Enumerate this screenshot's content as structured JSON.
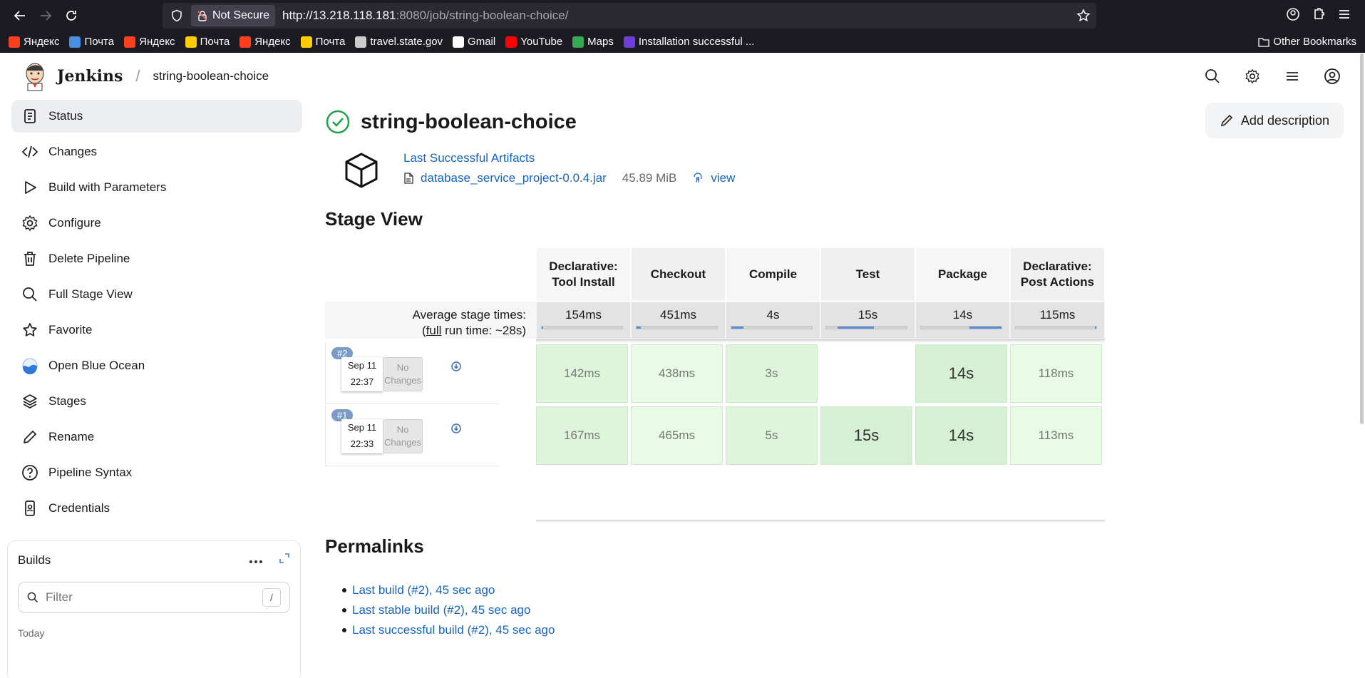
{
  "browser": {
    "not_secure_label": "Not Secure",
    "url_host": "http://13.218.118.181",
    "url_rest": ":8080/job/string-boolean-choice/",
    "bookmarks": [
      {
        "label": "Яндекс",
        "icon": "yandex-icon",
        "color": "#fc3f1d"
      },
      {
        "label": "Почта",
        "icon": "mail-icon",
        "color": "#4a90e2"
      },
      {
        "label": "Яндекс",
        "icon": "yandex-icon",
        "color": "#fc3f1d"
      },
      {
        "label": "Почта",
        "icon": "yandex-mail-icon",
        "color": "#ffcc00"
      },
      {
        "label": "Яндекс",
        "icon": "yandex-icon",
        "color": "#fc3f1d"
      },
      {
        "label": "Почта",
        "icon": "yandex-mail-icon",
        "color": "#ffcc00"
      },
      {
        "label": "travel.state.gov",
        "icon": "site-icon",
        "color": "#cccccc"
      },
      {
        "label": "Gmail",
        "icon": "google-icon",
        "color": "#ffffff"
      },
      {
        "label": "YouTube",
        "icon": "youtube-icon",
        "color": "#ff0000"
      },
      {
        "label": "Maps",
        "icon": "maps-icon",
        "color": "#34a853"
      },
      {
        "label": "Installation successful ...",
        "icon": "install-icon",
        "color": "#6c3fd6"
      }
    ],
    "other_bookmarks": "Other Bookmarks"
  },
  "header": {
    "brand": "Jenkins",
    "breadcrumb": "string-boolean-choice"
  },
  "sidebar": {
    "items": [
      {
        "label": "Status",
        "icon": "status-icon"
      },
      {
        "label": "Changes",
        "icon": "code-icon"
      },
      {
        "label": "Build with Parameters",
        "icon": "play-icon"
      },
      {
        "label": "Configure",
        "icon": "gear-icon"
      },
      {
        "label": "Delete Pipeline",
        "icon": "trash-icon"
      },
      {
        "label": "Full Stage View",
        "icon": "search-icon"
      },
      {
        "label": "Favorite",
        "icon": "star-icon"
      },
      {
        "label": "Open Blue Ocean",
        "icon": "blue-ocean-icon"
      },
      {
        "label": "Stages",
        "icon": "layers-icon"
      },
      {
        "label": "Rename",
        "icon": "pencil-icon"
      },
      {
        "label": "Pipeline Syntax",
        "icon": "help-icon"
      },
      {
        "label": "Credentials",
        "icon": "credentials-icon"
      }
    ],
    "builds": {
      "title": "Builds",
      "filter_placeholder": "Filter",
      "shortcut": "/",
      "group_label": "Today"
    }
  },
  "main": {
    "title": "string-boolean-choice",
    "add_description": "Add description",
    "artifacts": {
      "title": "Last Successful Artifacts",
      "file": "database_service_project-0.0.4.jar",
      "size": "45.89 MiB",
      "view": "view"
    },
    "stage_view_title": "Stage View",
    "stage_view": {
      "stages": [
        "Declarative: Tool Install",
        "Checkout",
        "Compile",
        "Test",
        "Package",
        "Declarative: Post Actions"
      ],
      "avg_label_1": "Average stage times:",
      "avg_label_2_prefix": "(",
      "avg_label_2_link": "full",
      "avg_label_2_suffix": " run time: ~28s)",
      "averages": [
        "154ms",
        "451ms",
        "4s",
        "15s",
        "14s",
        "115ms"
      ],
      "average_bar_fill": [
        0.0,
        0.05,
        0.15,
        0.45,
        0.4,
        0.02
      ],
      "runs": [
        {
          "badge": "#2",
          "date": "Sep 11",
          "time": "22:37",
          "no_changes_1": "No",
          "no_changes_2": "Changes",
          "cells": [
            "142ms",
            "438ms",
            "3s",
            "",
            "14s",
            "118ms"
          ]
        },
        {
          "badge": "#1",
          "date": "Sep 11",
          "time": "22:33",
          "no_changes_1": "No",
          "no_changes_2": "Changes",
          "cells": [
            "167ms",
            "465ms",
            "5s",
            "15s",
            "14s",
            "113ms"
          ]
        }
      ]
    },
    "permalinks_title": "Permalinks",
    "permalinks": [
      "Last build (#2), 45 sec ago",
      "Last stable build (#2), 45 sec ago",
      "Last successful build (#2), 45 sec ago"
    ]
  }
}
